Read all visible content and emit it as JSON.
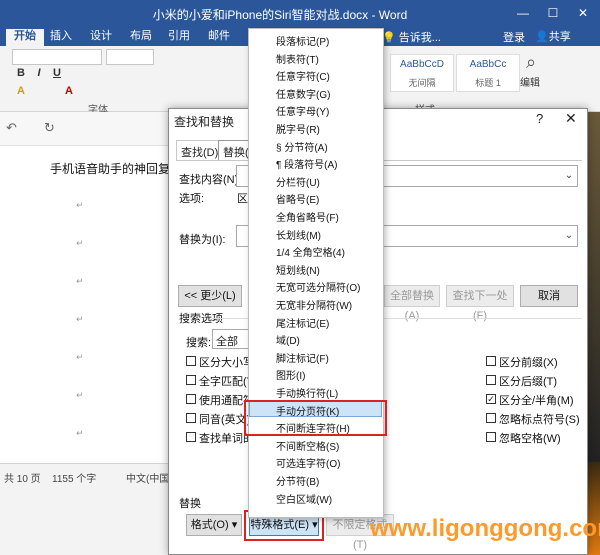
{
  "window": {
    "title": "小米的小爱和iPhone的Siri智能对战.docx - Word",
    "min": "—",
    "max": "☐",
    "close": "✕"
  },
  "ribbon": {
    "tabs": [
      "开始",
      "插入",
      "设计",
      "布局",
      "引用",
      "邮件"
    ],
    "tell_me": "告诉我...",
    "login": "登录",
    "share": "共享",
    "fmt_buttons": [
      "B",
      "I",
      "U",
      "A",
      "A"
    ],
    "font_group": "字体",
    "styles_group": "样式",
    "edit_label": "编辑",
    "styles": [
      {
        "preview": "AaBbCcD",
        "name": "无间隔"
      },
      {
        "preview": "AaBbCc",
        "name": "标题 1"
      }
    ]
  },
  "document": {
    "text": "手机语音助手的神回复，",
    "para_mark": "↵"
  },
  "statusbar": {
    "pages": "共 10 页",
    "words": "1155 个字",
    "lang": "中文(中国"
  },
  "dialog": {
    "title": "查找和替换",
    "help": "?",
    "close": "✕",
    "tabs": [
      "查找(D)",
      "替换(P)"
    ],
    "find_label": "查找内容(N):",
    "options_label": "选项:",
    "options_value": "区分",
    "replace_label": "替换为(I):",
    "less_button": "<< 更少(L)",
    "replace_all_button": "全部替换(A)",
    "find_next_button": "查找下一处(F)",
    "cancel_button": "取消",
    "search_options_heading": "搜索选项",
    "search_label": "搜索:",
    "search_value": "全部",
    "left_checks": [
      {
        "label": "区分大小写(H)",
        "checked": false
      },
      {
        "label": "全字匹配(Y)",
        "checked": false
      },
      {
        "label": "使用通配符(U)",
        "checked": false
      },
      {
        "label": "同音(英文)(K)",
        "checked": false
      },
      {
        "label": "查找单词的所有形式(英文)(W)",
        "checked": false
      }
    ],
    "right_checks": [
      {
        "label": "区分前缀(X)",
        "checked": false
      },
      {
        "label": "区分后缀(T)",
        "checked": false
      },
      {
        "label": "区分全/半角(M)",
        "checked": true
      },
      {
        "label": "忽略标点符号(S)",
        "checked": false
      },
      {
        "label": "忽略空格(W)",
        "checked": false
      }
    ],
    "replace_heading": "替换",
    "format_button": "格式(O) ▾",
    "special_button": "特殊格式(E) ▾",
    "no_format_button": "不限定格式(T)"
  },
  "menu": {
    "items": [
      "段落标记(P)",
      "制表符(T)",
      "任意字符(C)",
      "任意数字(G)",
      "任意字母(Y)",
      "脱字号(R)",
      "§ 分节符(A)",
      "¶ 段落符号(A)",
      "分栏符(U)",
      "省略号(E)",
      "全角省略号(F)",
      "长划线(M)",
      "1/4 全角空格(4)",
      "短划线(N)",
      "无宽可选分隔符(O)",
      "无宽非分隔符(W)",
      "尾注标记(E)",
      "域(D)",
      "脚注标记(F)",
      "图形(I)",
      "手动换行符(L)",
      "手动分页符(K)",
      "不间断连字符(H)",
      "不间断空格(S)",
      "可选连字符(O)",
      "分节符(B)",
      "空白区域(W)"
    ],
    "highlighted_index": 21
  },
  "watermark": "www.ligonggong.com",
  "colors": {
    "title_bar": "#2b579a",
    "highlight": "#cde3f6",
    "red_callout": "#e02020",
    "watermark": "#ff9a2a"
  }
}
